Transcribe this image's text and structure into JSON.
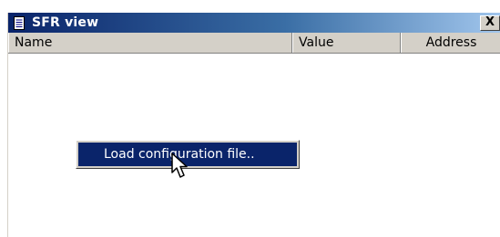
{
  "window": {
    "title": "SFR view",
    "title_icon": "document-icon",
    "close_label": "X"
  },
  "columns": [
    {
      "label": "Name"
    },
    {
      "label": "Value"
    },
    {
      "label": "Address"
    }
  ],
  "context_menu": {
    "items": [
      {
        "label": "Load configuration file.."
      }
    ]
  },
  "colors": {
    "titlebar_start": "#0a246a",
    "titlebar_end": "#a6caf0",
    "menu_highlight": "#0a246a",
    "chrome": "#d4d0c8"
  },
  "cursor": "arrow-cursor-icon"
}
